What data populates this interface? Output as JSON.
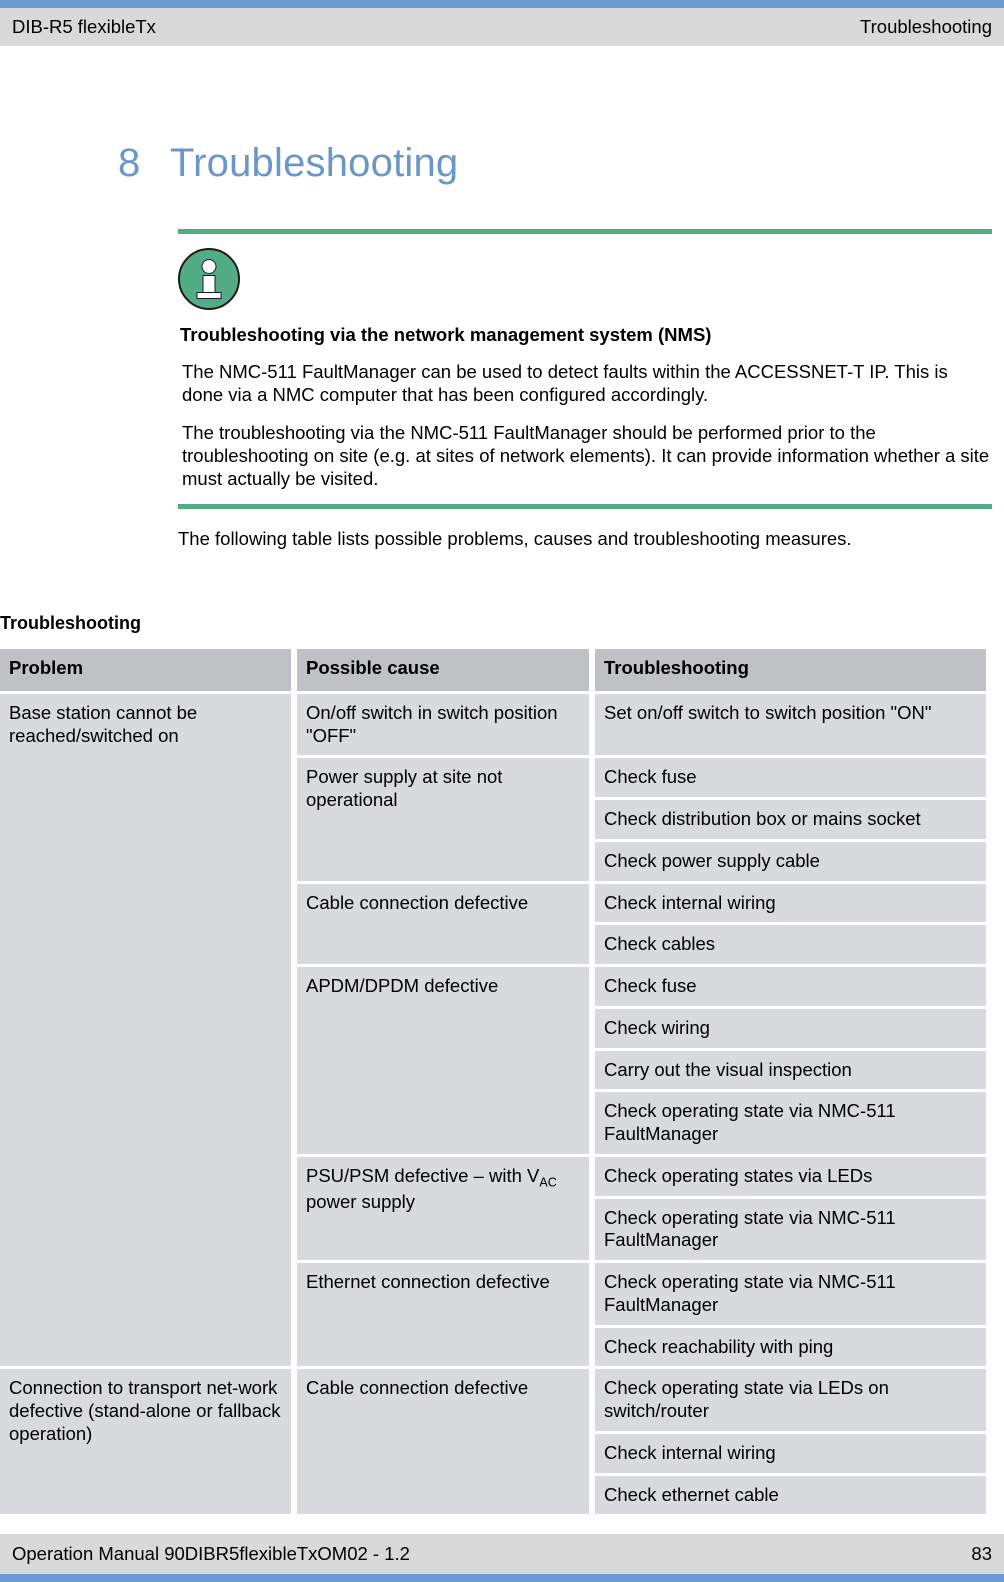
{
  "header": {
    "left": "DIB-R5 flexibleTx",
    "right": "Troubleshooting",
    "rule_color": "#6b9bd2",
    "band_color": "#d9d9d9"
  },
  "chapter": {
    "number": "8",
    "title": "Troubleshooting",
    "color": "#6b96c8"
  },
  "note": {
    "icon": "info-icon",
    "rule_color": "#52ad87",
    "title": "Troubleshooting via the network management system (NMS)",
    "paragraphs": [
      "The NMC-511 FaultManager can be used to detect faults within the ACCESSNET-T IP. This is done via a NMC computer that has been configured accordingly.",
      "The troubleshooting via the NMC-511 FaultManager should be performed prior to the troubleshooting on site (e.g. at sites of network elements). It can provide information whether a site must actually be visited."
    ]
  },
  "lead_paragraph": "The following table lists possible problems, causes and troubleshooting measures.",
  "table": {
    "caption": "Troubleshooting",
    "headers": [
      "Problem",
      "Possible cause",
      "Troubleshooting"
    ],
    "header_bg": "#bfc1c4",
    "cell_bg": "#d8dadd",
    "groups": [
      {
        "problem": "Base station cannot be reached/switched on",
        "causes": [
          {
            "cause": "On/off switch in switch position \"OFF\"",
            "measures": [
              "Set on/off switch to switch position \"ON\""
            ]
          },
          {
            "cause": "Power supply at site not operational",
            "measures": [
              "Check fuse",
              "Check distribution box or mains socket",
              "Check power supply cable"
            ]
          },
          {
            "cause": "Cable connection defective",
            "measures": [
              "Check internal wiring",
              "Check cables"
            ]
          },
          {
            "cause": "APDM/DPDM defective",
            "measures": [
              "Check fuse",
              "Check wiring",
              "Carry out the visual inspection",
              "Check operating state via NMC-511 FaultManager"
            ]
          },
          {
            "cause_prefix": "PSU/PSM defective – with V",
            "cause_sub": "AC",
            "cause_suffix": " power supply",
            "measures": [
              "Check operating states via LEDs",
              "Check operating state via NMC-511 FaultManager"
            ]
          },
          {
            "cause": "Ethernet connection defective",
            "measures": [
              "Check operating state via NMC-511 FaultManager",
              "Check reachability with ping"
            ]
          }
        ]
      },
      {
        "problem": "Connection to transport net-work defective (stand-alone or fallback operation)",
        "causes": [
          {
            "cause": "Cable connection defective",
            "measures": [
              "Check operating state via LEDs on switch/router",
              "Check internal wiring",
              "Check ethernet cable"
            ]
          }
        ]
      }
    ]
  },
  "footer": {
    "left": "Operation Manual 90DIBR5flexibleTxOM02 - 1.2",
    "right": "83"
  }
}
